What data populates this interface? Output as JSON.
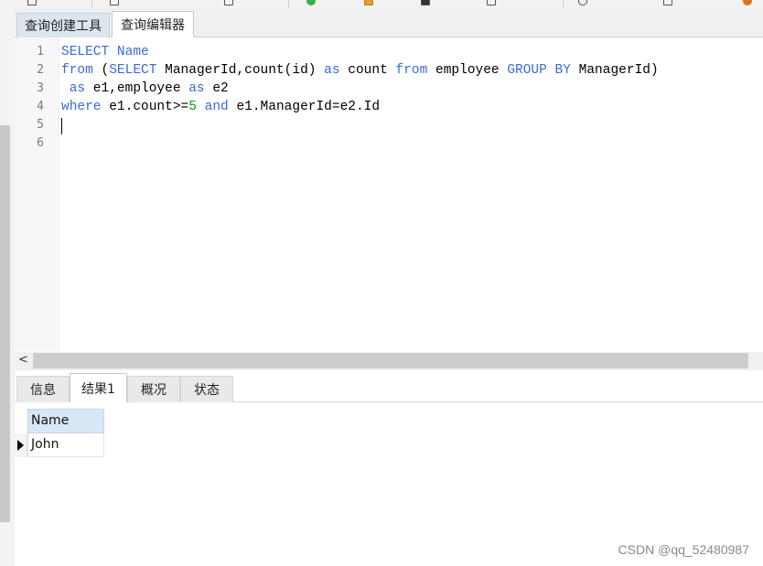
{
  "editor_tabs": [
    {
      "label": "查询创建工具"
    },
    {
      "label": "查询编辑器"
    }
  ],
  "editor": {
    "line_numbers": [
      "1",
      "2",
      "3",
      "4",
      "5",
      "6"
    ],
    "lines": [
      [
        {
          "t": "SELECT Name",
          "k": "kw"
        }
      ],
      [
        {
          "t": "from",
          "k": "kw"
        },
        {
          "t": " (",
          "k": ""
        },
        {
          "t": "SELECT",
          "k": "kw"
        },
        {
          "t": " ManagerId,count(id) ",
          "k": ""
        },
        {
          "t": "as",
          "k": "kw"
        },
        {
          "t": " count ",
          "k": ""
        },
        {
          "t": "from",
          "k": "kw"
        },
        {
          "t": " employee ",
          "k": ""
        },
        {
          "t": "GROUP BY",
          "k": "kw"
        },
        {
          "t": " ManagerId)",
          "k": ""
        }
      ],
      [
        {
          "t": " ",
          "k": ""
        },
        {
          "t": "as",
          "k": "kw"
        },
        {
          "t": " e1,employee ",
          "k": ""
        },
        {
          "t": "as",
          "k": "kw"
        },
        {
          "t": " e2",
          "k": ""
        }
      ],
      [
        {
          "t": "where",
          "k": "kw"
        },
        {
          "t": " e1.count>=",
          "k": ""
        },
        {
          "t": "5",
          "k": "num"
        },
        {
          "t": " ",
          "k": ""
        },
        {
          "t": "and",
          "k": "kw"
        },
        {
          "t": " e1.ManagerId=e2.Id",
          "k": ""
        }
      ],
      [],
      []
    ]
  },
  "hscroll": {
    "arrow": "<"
  },
  "result_tabs": [
    {
      "label": "信息"
    },
    {
      "label": "结果1"
    },
    {
      "label": "概况"
    },
    {
      "label": "状态"
    }
  ],
  "result": {
    "columns": [
      "Name"
    ],
    "rows": [
      [
        "John"
      ]
    ]
  },
  "watermark": "CSDN @qq_52480987",
  "colors": {
    "keyword": "#3a6bd6",
    "number": "#1a8f1a",
    "header_bg": "#d8e7f5"
  }
}
